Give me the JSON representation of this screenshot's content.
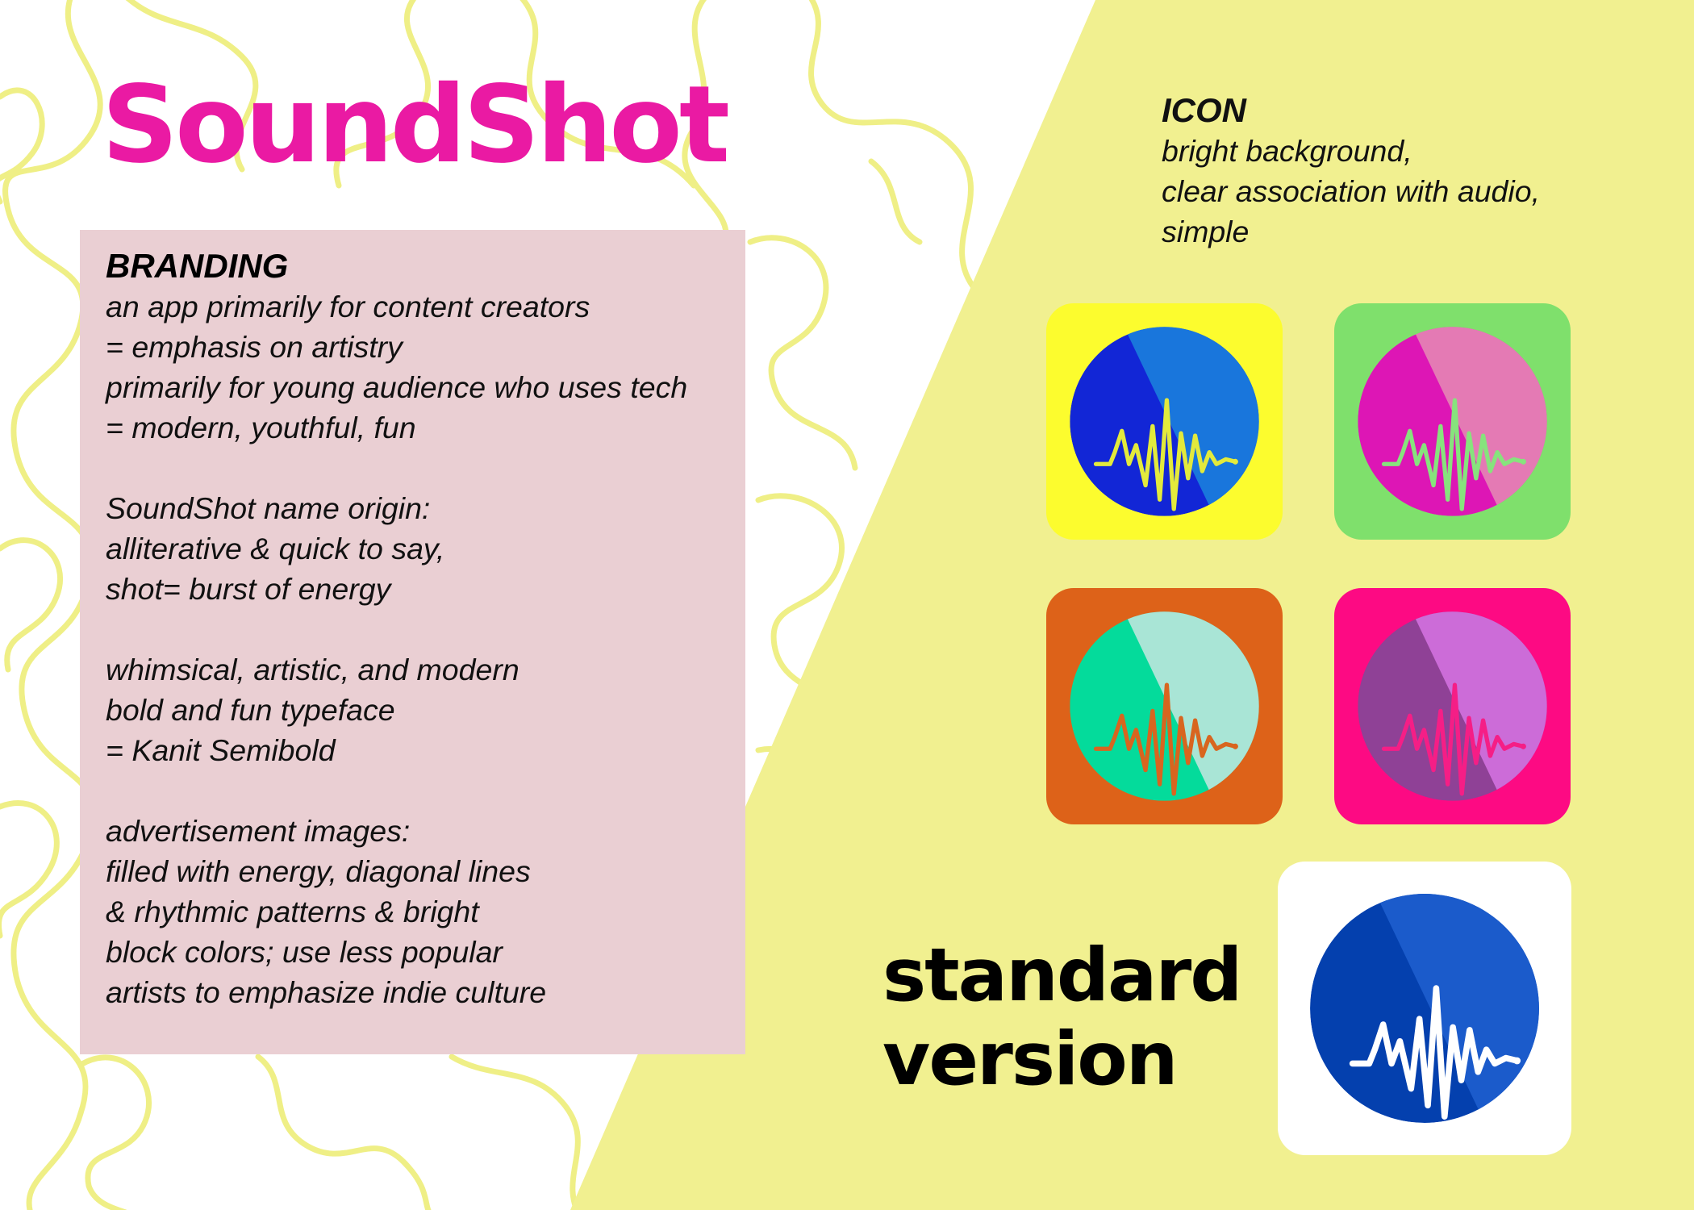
{
  "title": "SoundShot",
  "colors": {
    "title_pink": "#ea1aa3",
    "swirl_yellow": "#efef86",
    "panel_right_bg": "#f1f090",
    "branding_panel_bg": "#eacfd3"
  },
  "branding": {
    "heading": "BRANDING",
    "lines": [
      "an app primarily for content creators",
      "= emphasis on artistry",
      "primarily for young audience who uses tech",
      "= modern, youthful, fun",
      "",
      "SoundShot name origin:",
      "alliterative & quick to say,",
      "shot= burst of energy",
      "",
      "whimsical, artistic, and modern",
      "bold and fun typeface",
      "= Kanit Semibold",
      "",
      "advertisement images:",
      "filled with energy, diagonal lines",
      "& rhythmic patterns & bright",
      "block colors; use less popular",
      "artists to emphasize indie culture"
    ]
  },
  "icon_notes": {
    "heading": "ICON",
    "lines": [
      "bright background,",
      "clear association with audio,",
      "simple"
    ]
  },
  "icons": [
    {
      "icon": "soundwave-app-icon",
      "bg": "#fcfc2e",
      "circle_dark": "#1226d6",
      "circle_light": "#1976dc",
      "wave": "#e3ea3c"
    },
    {
      "icon": "soundwave-app-icon",
      "bg": "#7fe06c",
      "circle_dark": "#dd16b5",
      "circle_light": "#e47ab4",
      "wave": "#87e37d"
    },
    {
      "icon": "soundwave-app-icon",
      "bg": "#dd6219",
      "circle_dark": "#04db9b",
      "circle_light": "#a9e5d6",
      "wave": "#d8651f"
    },
    {
      "icon": "soundwave-app-icon",
      "bg": "#fd0a83",
      "circle_dark": "#8f4196",
      "circle_light": "#cc6cd8",
      "wave": "#f51e86"
    }
  ],
  "standard": {
    "label_line1": "standard",
    "label_line2": "version",
    "icon": "soundwave-app-icon",
    "bg": "#ffffff",
    "circle_dark": "#0440ae",
    "circle_light": "#1b5bcb",
    "wave": "#ffffff"
  }
}
